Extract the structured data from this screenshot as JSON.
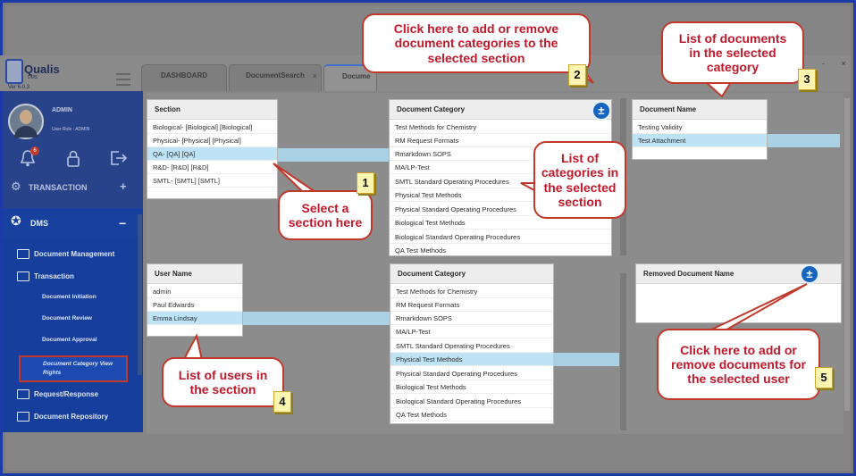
{
  "app": {
    "name": "Qualis",
    "sub": "DMS",
    "version": "Ver 6.0.3"
  },
  "tabs": [
    {
      "label": "DASHBOARD"
    },
    {
      "label": "DocumentSearch",
      "close": "×"
    },
    {
      "label": "Docume"
    }
  ],
  "window_controls": "- ×",
  "user": {
    "name": "ADMIN",
    "role": "User Role : ADMIN",
    "notification_count": "6"
  },
  "sidebar": {
    "transaction": "TRANSACTION",
    "dms": "DMS",
    "items": [
      {
        "label": "Document Management"
      },
      {
        "label": "Transaction"
      }
    ],
    "sub_items": [
      {
        "label": "Document Initiation"
      },
      {
        "label": "Document Review"
      },
      {
        "label": "Document Approval"
      }
    ],
    "active_sub": "Document Category View Rights",
    "items_bottom": [
      {
        "label": "Request/Response"
      },
      {
        "label": "Document Repository"
      }
    ]
  },
  "section_panel": {
    "header": "Section",
    "rows": [
      "Biological- [Biological] [Biological]",
      "Physical- [Physical] [Physical]",
      "QA- [QA] [QA]",
      "R&D- [R&D] [R&D]",
      "SMTL- [SMTL] [SMTL]"
    ],
    "selected": 2
  },
  "category_panel": {
    "header": "Document Category",
    "add_icon": "±",
    "rows": [
      "Test Methods for Chemistry",
      "RM Request Formats",
      "Rmarkdown SOPS",
      "MA/LP-Test",
      "SMTL Standard Operating Procedures",
      "Physical Test Methods",
      "Physical Standard Operating Procedures",
      "Biological Test Methods",
      "Biological Standard Operating Procedures",
      "QA Test Methods"
    ]
  },
  "document_panel": {
    "header": "Document Name",
    "rows": [
      "Testing Validity",
      "Test Attachment"
    ],
    "selected": 1
  },
  "user_panel": {
    "header": "User Name",
    "rows": [
      "admin",
      "Paul Edwards",
      "Emma Lindsay"
    ],
    "selected": 2
  },
  "category_panel2": {
    "header": "Document Category",
    "rows": [
      "Test Methods for Chemistry",
      "RM Request Formats",
      "Rmarkdown SOPS",
      "MA/LP-Test",
      "SMTL Standard Operating Procedures",
      "Physical Test Methods",
      "Physical Standard Operating Procedures",
      "Biological Test Methods",
      "Biological Standard Operating Procedures",
      "QA Test Methods"
    ],
    "selected": 5
  },
  "removed_panel": {
    "header": "Removed Document Name",
    "add_icon": "±"
  },
  "callouts": [
    {
      "text": "Select a section here",
      "number": "1"
    },
    {
      "text": "Click here to add or remove document categories to the selected section",
      "number": "2"
    },
    {
      "text": "List of documents in the selected category",
      "number": "3"
    },
    {
      "text": "List of users in the section",
      "number": "4"
    },
    {
      "text": "Click here to add or remove documents for the selected user",
      "number": "5"
    },
    {
      "text": "List of categories in the selected section"
    }
  ],
  "colors": {
    "frame": "#1c3aa8",
    "sidebar": "#163e9d",
    "callout_text": "#c0192b",
    "selection": "#bde3f5",
    "accent": "#1565c0"
  }
}
